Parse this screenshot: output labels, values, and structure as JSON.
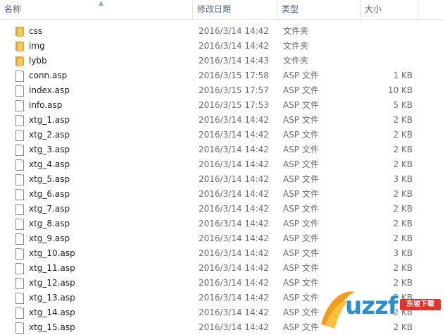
{
  "columns": {
    "name": "名称",
    "date": "修改日期",
    "type": "类型",
    "size": "大小"
  },
  "files": [
    {
      "name": "css",
      "date": "2016/3/14 14:42",
      "type": "文件夹",
      "size": "",
      "kind": "folder"
    },
    {
      "name": "img",
      "date": "2016/3/14 14:42",
      "type": "文件夹",
      "size": "",
      "kind": "folder"
    },
    {
      "name": "lybb",
      "date": "2016/3/14 14:43",
      "type": "文件夹",
      "size": "",
      "kind": "folder"
    },
    {
      "name": "conn.asp",
      "date": "2016/3/15 17:58",
      "type": "ASP 文件",
      "size": "1 KB",
      "kind": "file"
    },
    {
      "name": "index.asp",
      "date": "2016/3/15 17:57",
      "type": "ASP 文件",
      "size": "10 KB",
      "kind": "file"
    },
    {
      "name": "info.asp",
      "date": "2016/3/15 17:53",
      "type": "ASP 文件",
      "size": "5 KB",
      "kind": "file"
    },
    {
      "name": "xtg_1.asp",
      "date": "2016/3/14 14:42",
      "type": "ASP 文件",
      "size": "2 KB",
      "kind": "file"
    },
    {
      "name": "xtg_2.asp",
      "date": "2016/3/14 14:42",
      "type": "ASP 文件",
      "size": "2 KB",
      "kind": "file"
    },
    {
      "name": "xtg_3.asp",
      "date": "2016/3/14 14:42",
      "type": "ASP 文件",
      "size": "2 KB",
      "kind": "file"
    },
    {
      "name": "xtg_4.asp",
      "date": "2016/3/14 14:42",
      "type": "ASP 文件",
      "size": "2 KB",
      "kind": "file"
    },
    {
      "name": "xtg_5.asp",
      "date": "2016/3/14 14:42",
      "type": "ASP 文件",
      "size": "3 KB",
      "kind": "file"
    },
    {
      "name": "xtg_6.asp",
      "date": "2016/3/14 14:42",
      "type": "ASP 文件",
      "size": "2 KB",
      "kind": "file"
    },
    {
      "name": "xtg_7.asp",
      "date": "2016/3/14 14:42",
      "type": "ASP 文件",
      "size": "2 KB",
      "kind": "file"
    },
    {
      "name": "xtg_8.asp",
      "date": "2016/3/14 14:42",
      "type": "ASP 文件",
      "size": "2 KB",
      "kind": "file"
    },
    {
      "name": "xtg_9.asp",
      "date": "2016/3/14 14:42",
      "type": "ASP 文件",
      "size": "2 KB",
      "kind": "file"
    },
    {
      "name": "xtg_10.asp",
      "date": "2016/3/14 14:42",
      "type": "ASP 文件",
      "size": "3 KB",
      "kind": "file"
    },
    {
      "name": "xtg_11.asp",
      "date": "2016/3/14 14:42",
      "type": "ASP 文件",
      "size": "2 KB",
      "kind": "file"
    },
    {
      "name": "xtg_12.asp",
      "date": "2016/3/14 14:42",
      "type": "ASP 文件",
      "size": "2 KB",
      "kind": "file"
    },
    {
      "name": "xtg_13.asp",
      "date": "2016/3/14 14:42",
      "type": "ASP 文件",
      "size": "2 KB",
      "kind": "file"
    },
    {
      "name": "xtg_14.asp",
      "date": "2016/3/14 14:42",
      "type": "ASP 文件",
      "size": "2 KB",
      "kind": "file"
    },
    {
      "name": "xtg_15.asp",
      "date": "2016/3/14 14:42",
      "type": "ASP 文件",
      "size": "2 KB",
      "kind": "file"
    }
  ],
  "watermark": {
    "logo_text": "uzzf",
    "badge_text": "东坡下载"
  },
  "icons": {
    "folder": "folder-icon",
    "file": "file-icon",
    "sort": "sort-ascending-icon"
  }
}
